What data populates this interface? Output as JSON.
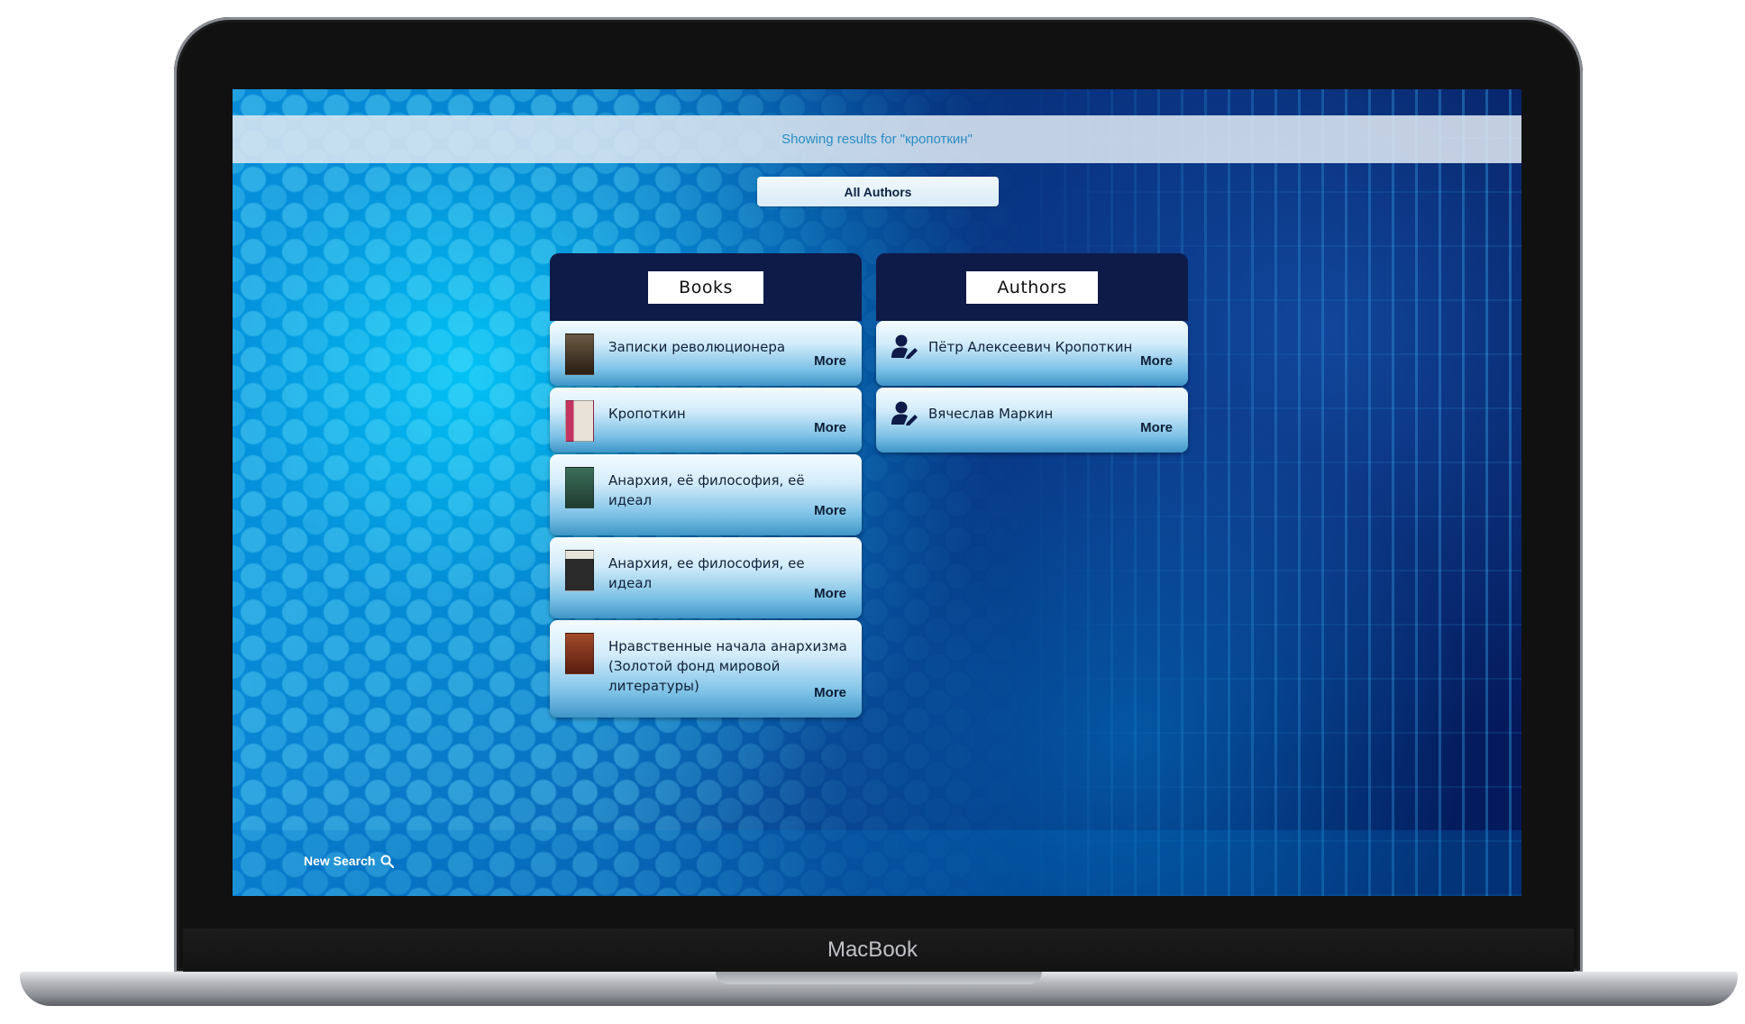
{
  "device": {
    "brand": "MacBook"
  },
  "results_header": {
    "text": "Showing results for \"кропоткин\""
  },
  "filter": {
    "selected": "All Authors"
  },
  "books": {
    "tab_label": "Books",
    "items": [
      {
        "title": "Записки революционера",
        "more": "More",
        "cover_color": "#3a2a1e"
      },
      {
        "title": "Кропоткин",
        "more": "More",
        "cover_color": "#c53360"
      },
      {
        "title": "Анархия, её философия, её идеал",
        "more": "More",
        "cover_color": "#2f5a48"
      },
      {
        "title": "Анархия, ее философия, ее идеал",
        "more": "More",
        "cover_color": "#2a2a2a"
      },
      {
        "title": "Нравственные начала анархизма (Золотой фонд мировой литературы)",
        "more": "More",
        "cover_color": "#8a3b22"
      }
    ]
  },
  "authors": {
    "tab_label": "Authors",
    "items": [
      {
        "name": "Пётр Алексеевич Кропоткин",
        "more": "More"
      },
      {
        "name": "Вячеслав Маркин",
        "more": "More"
      }
    ]
  },
  "footer": {
    "new_search_label": "New Search"
  }
}
